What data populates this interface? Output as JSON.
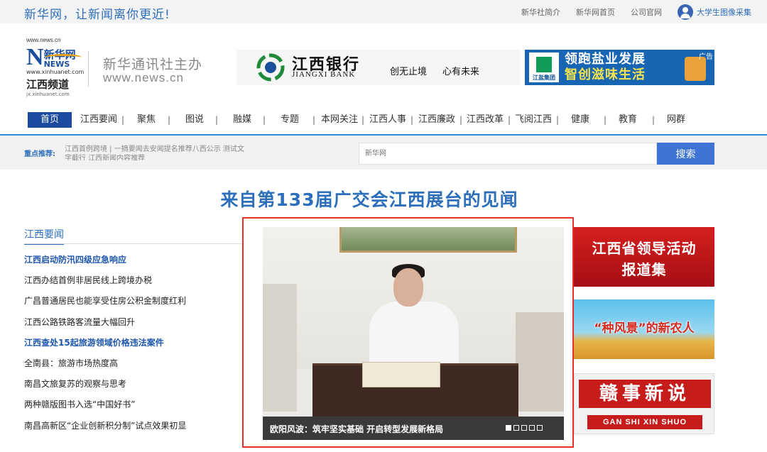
{
  "topbar": {
    "slogan": "新华网，让新闻离你更近!",
    "links": [
      "新华社简介",
      "新华网首页",
      "公司官网"
    ],
    "user_label": "大学生图像采集"
  },
  "header": {
    "logo_url": "www.news.cn",
    "logo_name": "新华网",
    "logo_news": "NEWS",
    "logo_sub": "www.xinhuanet.com",
    "channel": "江西频道",
    "channel_url": "jx.xinhuanet.com",
    "sponsor": "新华通讯社主办",
    "sponsor_url": "www.news.cn"
  },
  "ads": {
    "bank": {
      "name": "江西银行",
      "en": "JIANGXI BANK",
      "slogan_1": "创无止境",
      "slogan_2": "心有未来"
    },
    "salt": {
      "line1": "领跑盐业发展",
      "line2": "智创滋味生活",
      "company": "江盐集团",
      "tag": "广告"
    }
  },
  "nav": {
    "items": [
      "首页",
      "江西要闻",
      "聚焦",
      "图说",
      "融媒",
      "专题",
      "本网关注",
      "江西人事",
      "江西廉政",
      "江西改革",
      "飞阅江西",
      "健康",
      "教育",
      "网群"
    ]
  },
  "recommend": {
    "label": "重点推荐:",
    "text": "江西首例跨境 | 一摘要闻去安闻提名推荐八西公示 测试文字截行 江西新闻内容推荐"
  },
  "search": {
    "placeholder": "新华网",
    "button": "搜索"
  },
  "headline": "来自第133届广交会江西展台的见闻",
  "left": {
    "section_title": "江西要闻",
    "news": [
      {
        "text": "江西启动防汛四级应急响应",
        "lead": true
      },
      {
        "text": "江西办结首例非居民线上跨境办税",
        "lead": false
      },
      {
        "text": "广昌普通居民也能享受住房公积金制度红利",
        "lead": false
      },
      {
        "text": "江西公路铁路客流量大幅回升",
        "lead": false
      },
      {
        "text": "江西查处15起旅游领域价格违法案件",
        "lead": true
      },
      {
        "text": "全南县：旅游市场热度高",
        "lead": false
      },
      {
        "text": "南昌文旅复苏的观察与思考",
        "lead": false
      },
      {
        "text": "两种赣版图书入选“中国好书”",
        "lead": false
      },
      {
        "text": "南昌高新区“企业创新积分制”试点效果初显",
        "lead": false
      }
    ]
  },
  "slideshow": {
    "caption": "欧阳风波：筑牢坚实基础 开启转型发展新格局",
    "dot_count": 5,
    "active_dot": 0
  },
  "banners": {
    "b1_line1": "江西省领导活动",
    "b1_line2": "报道集",
    "b2": "“种风景”的新农人",
    "b3_cn": "赣事新说",
    "b3_en": "GAN SHI XIN SHUO"
  },
  "colors": {
    "brand_blue": "#2d6fbb",
    "nav_active": "#1b4aa0",
    "search_button": "#3d74d6",
    "highlight_red": "#e5312a"
  }
}
